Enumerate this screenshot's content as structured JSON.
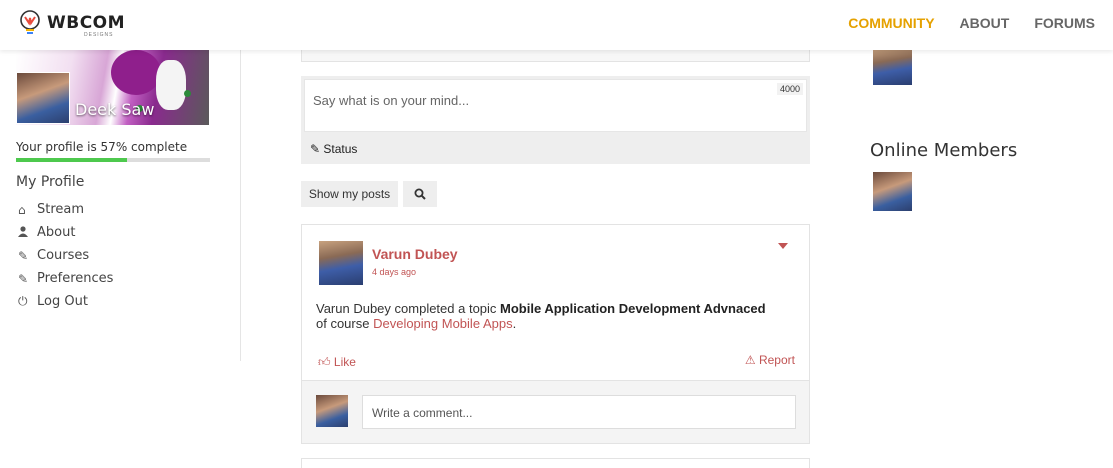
{
  "brand": {
    "name": "WBCOM",
    "sub": "DESIGNS"
  },
  "nav": [
    {
      "label": "COMMUNITY",
      "active": true
    },
    {
      "label": "ABOUT",
      "active": false
    },
    {
      "label": "FORUMS",
      "active": false
    }
  ],
  "profile": {
    "name": "Deek Saw",
    "progress_text": "Your profile is 57% complete",
    "progress_percent": 57,
    "menu_title": "My Profile",
    "menu": [
      {
        "icon": "home-icon",
        "label": "Stream"
      },
      {
        "icon": "user-icon",
        "label": "About"
      },
      {
        "icon": "edit-icon",
        "label": "Courses"
      },
      {
        "icon": "edit-icon",
        "label": "Preferences"
      },
      {
        "icon": "power-icon",
        "label": "Log Out"
      }
    ]
  },
  "composer": {
    "placeholder": "Say what is on your mind...",
    "char_count": "4000",
    "status_tab": "Status"
  },
  "filters": {
    "show_my_posts": "Show my posts"
  },
  "activity": {
    "author": "Varun Dubey",
    "time": "4 days ago",
    "text_prefix": "Varun Dubey completed a topic ",
    "topic": "Mobile Application Development Advnaced",
    "text_mid": " of course ",
    "course": "Developing Mobile Apps",
    "text_end": ".",
    "like_label": "Like",
    "report_label": "Report",
    "comment_placeholder": "Write a comment..."
  },
  "right": {
    "online_title": "Online Members"
  },
  "colors": {
    "accent": "#e5a100",
    "link": "#c15454",
    "progress": "#4ec94e"
  }
}
